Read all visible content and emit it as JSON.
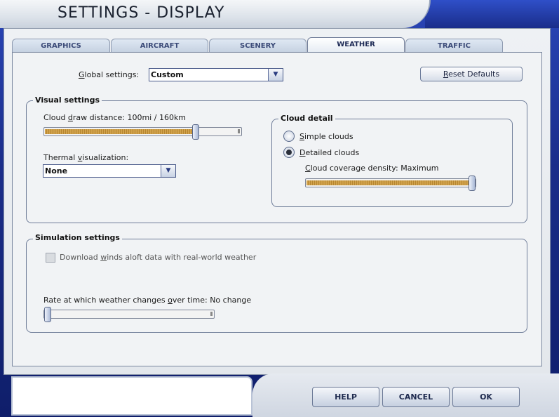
{
  "window": {
    "title": "SETTINGS - DISPLAY"
  },
  "tabs": [
    {
      "label": "GRAPHICS",
      "active": false
    },
    {
      "label": "AIRCRAFT",
      "active": false
    },
    {
      "label": "SCENERY",
      "active": false
    },
    {
      "label": "WEATHER",
      "active": true
    },
    {
      "label": "TRAFFIC",
      "active": false
    }
  ],
  "global": {
    "label_prefix": "G",
    "label_rest": "lobal settings:",
    "value": "Custom"
  },
  "reset_button": {
    "label_prefix": "R",
    "label_rest": "eset Defaults"
  },
  "visual": {
    "title": "Visual settings",
    "cloud_distance": {
      "pre": "Cloud ",
      "u": "d",
      "post": "raw distance: 100mi / 160km",
      "level": 0.78
    },
    "thermal": {
      "pre": "Thermal ",
      "u": "v",
      "post": "isualization:",
      "value": "None"
    },
    "cloud_detail": {
      "title": "Cloud detail",
      "simple": {
        "u": "S",
        "post": "imple clouds",
        "selected": false
      },
      "detailed": {
        "u": "D",
        "post": "etailed clouds",
        "selected": true
      },
      "coverage": {
        "u": "C",
        "post": "loud coverage density: Maximum",
        "level": 1.0
      }
    }
  },
  "simulation": {
    "title": "Simulation settings",
    "winds": {
      "pre": "Download ",
      "u": "w",
      "post": "inds aloft data with real-world weather",
      "checked": false
    },
    "rate": {
      "pre": "Rate at which weather changes ",
      "u": "o",
      "post": "ver time: No change",
      "level": 0.0
    }
  },
  "buttons": {
    "help": "HELP",
    "cancel": "CANCEL",
    "ok": "OK"
  },
  "colors": {
    "frame": "#1c2f8c",
    "slider_fill": "#d1a24c"
  }
}
